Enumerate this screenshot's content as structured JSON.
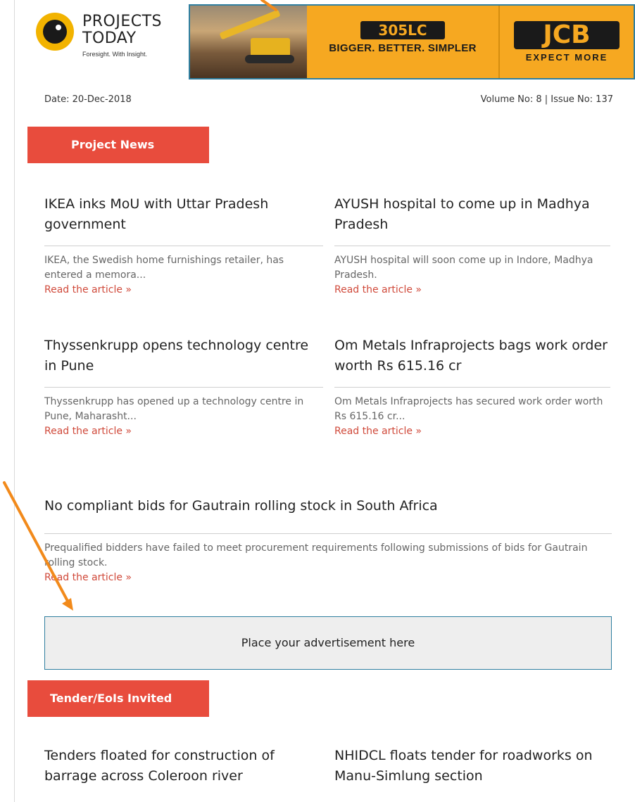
{
  "header": {
    "logo_line1": "PROJECTS",
    "logo_line2": "TODAY",
    "logo_tagline": "Foresight. With Insight.",
    "ad_model": "305LC",
    "ad_text": "BIGGER. BETTER. SIMPLER",
    "ad_brand": "JCB",
    "ad_slogan": "EXPECT MORE"
  },
  "meta": {
    "date": "Date: 20-Dec-2018",
    "volume": "Volume No: 8 | Issue No: 137"
  },
  "sections": {
    "project_news": "Project News",
    "tenders": "Tender/EoIs Invited"
  },
  "articles": [
    {
      "title": "IKEA inks MoU with Uttar Pradesh government",
      "summary": "IKEA, the Swedish home furnishings retailer, has entered a memora...",
      "link": "Read the article »"
    },
    {
      "title": "AYUSH hospital to come up in Madhya Pradesh",
      "summary": "AYUSH hospital will soon come up in Indore, Madhya Pradesh.",
      "link": "Read the article »"
    },
    {
      "title": "Thyssenkrupp opens technology centre in Pune",
      "summary": "Thyssenkrupp has opened up a technology centre in Pune, Maharasht...",
      "link": "Read the article »"
    },
    {
      "title": "Om Metals Infraprojects bags work order worth Rs 615.16 cr",
      "summary": "Om Metals Infraprojects has secured work order worth Rs 615.16 cr...",
      "link": "Read the article »"
    },
    {
      "title": "No compliant bids for Gautrain rolling stock in South Africa",
      "summary": "Prequalified bidders have failed to meet procurement requirements following submissions of bids for Gautrain rolling stock.",
      "link": "Read the article »"
    }
  ],
  "ad_placeholder": "Place your advertisement here",
  "tenders": [
    {
      "title": "Tenders floated for construction of barrage across Coleroon river"
    },
    {
      "title": "NHIDCL floats tender for roadworks on Manu-Simlung section"
    }
  ],
  "colors": {
    "accent_red": "#e84c3d",
    "link_red": "#d0493a",
    "banner_orange": "#f6a821",
    "annotation_arrow": "#f28a1b"
  }
}
